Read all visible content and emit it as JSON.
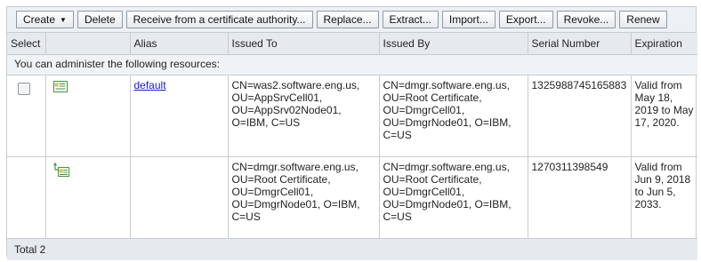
{
  "toolbar": {
    "buttons": {
      "create": "Create",
      "delete": "Delete",
      "receive": "Receive from a certificate authority...",
      "replace": "Replace...",
      "extract": "Extract...",
      "import": "Import...",
      "export": "Export...",
      "revoke": "Revoke...",
      "renew": "Renew"
    }
  },
  "table": {
    "columns": {
      "select": "Select",
      "icon": "",
      "alias": "Alias",
      "issued_to": "Issued To",
      "issued_by": "Issued By",
      "serial": "Serial Number",
      "expiration": "Expiration"
    },
    "info_text": "You can administer the following resources:",
    "rows": [
      {
        "alias": "default",
        "issued_to": "CN=was2.software.eng.us, OU=AppSrvCell01, OU=AppSrv02Node01, O=IBM, C=US",
        "issued_by": "CN=dmgr.software.eng.us, OU=Root Certificate, OU=DmgrCell01, OU=DmgrNode01, O=IBM, C=US",
        "serial": "1325988745165883",
        "expiration": "Valid from May 18, 2019 to May 17, 2020."
      },
      {
        "alias": "",
        "issued_to": "CN=dmgr.software.eng.us, OU=Root Certificate, OU=DmgrCell01, OU=DmgrNode01, O=IBM, C=US",
        "issued_by": "CN=dmgr.software.eng.us, OU=Root Certificate, OU=DmgrCell01, OU=DmgrNode01, O=IBM, C=US",
        "serial": "1270311398549",
        "expiration": "Valid from Jun 9, 2018 to Jun 5, 2033."
      }
    ],
    "total": "Total 2"
  },
  "colors": {
    "toolbar_bg": "#edf1f5",
    "header_bg": "#e6eaee",
    "border": "#c8ccd2",
    "link": "#1a1acc",
    "icon_green": "#3f9a3a",
    "icon_yellow": "#f2d04a"
  },
  "icons": {
    "row1": "personal-certificate-icon",
    "row2": "signer-certificate-icon",
    "create_menu": "caret-down-icon"
  }
}
